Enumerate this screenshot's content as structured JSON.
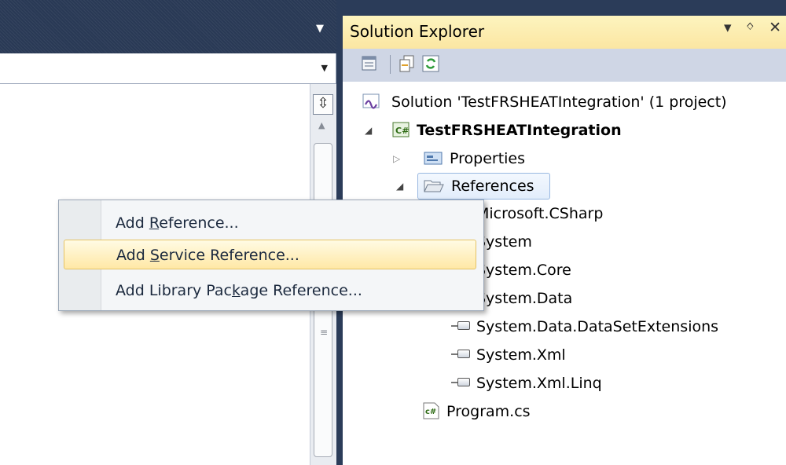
{
  "solution_explorer": {
    "title": "Solution Explorer",
    "header_buttons": {
      "dropdown": "▾",
      "pin": "ᛜ",
      "close": "✕"
    },
    "toolbar_icons": [
      "properties-icon",
      "show-all-files-icon",
      "refresh-icon"
    ],
    "tree": {
      "solution": "Solution 'TestFRSHEATIntegration' (1 project)",
      "project": "TestFRSHEATIntegration",
      "properties": "Properties",
      "references_folder": "References",
      "references": [
        "Microsoft.CSharp",
        "System",
        "System.Core",
        "System.Data",
        "System.Data.DataSetExtensions",
        "System.Xml",
        "System.Xml.Linq"
      ],
      "program_file": "Program.cs"
    }
  },
  "context_menu": {
    "items": [
      {
        "pre": "Add ",
        "key": "R",
        "post": "eference..."
      },
      {
        "pre": "Add ",
        "key": "S",
        "post": "ervice Reference..."
      },
      {
        "pre": "Add Library Pac",
        "key": "k",
        "post": "age Reference..."
      }
    ],
    "highlighted_index": 1
  },
  "colors": {
    "panel_header": "#fbe6a2",
    "toolbar": "#cfd6e5",
    "frame": "#2b3c59",
    "menu_highlight": "#ffe8a6"
  }
}
